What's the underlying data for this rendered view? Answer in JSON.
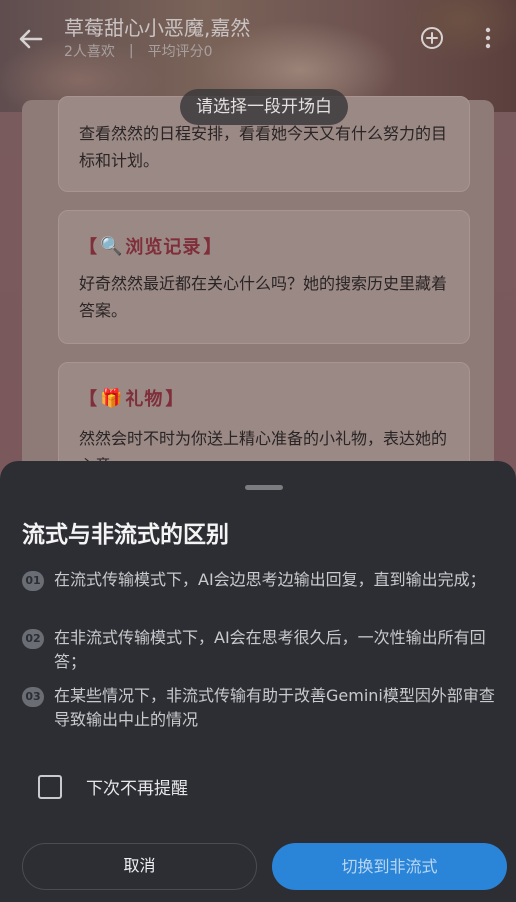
{
  "header": {
    "title": "草莓甜心小恶魔,嘉然",
    "likes": "2人喜欢",
    "separator": "|",
    "rating": "平均评分0",
    "prompt_pill": "请选择一段开场白"
  },
  "cards": [
    {
      "text": "查看然然的日程安排，看看她今天又有什么努力的目标和计划。"
    },
    {
      "bracket_open": "【",
      "emoji": "🔍",
      "title": "浏览记录",
      "bracket_close": "】",
      "text": "好奇然然最近都在关心什么吗？她的搜索历史里藏着答案。"
    },
    {
      "bracket_open": "【",
      "emoji": "🎁",
      "title": "礼物",
      "bracket_close": "】",
      "text": "然然会时不时为你送上精心准备的小礼物，表达她的心意。"
    }
  ],
  "sheet": {
    "title": "流式与非流式的区别",
    "notes": [
      {
        "num": "01",
        "text": "在流式传输模式下，AI会边思考边输出回复，直到输出完成；"
      },
      {
        "num": "02",
        "text": "在非流式传输模式下，AI会在思考很久后，一次性输出所有回答；"
      },
      {
        "num": "03",
        "text": "在某些情况下，非流式传输有助于改善Gemini模型因外部审查导致输出中止的情况"
      }
    ],
    "checkbox_label": "下次不再提醒",
    "checkbox_checked": false,
    "cancel_label": "取消",
    "switch_label": "切换到非流式"
  },
  "colors": {
    "sheet_bg": "#2c2e33",
    "primary_button": "#2a85d8",
    "card_title": "#7f2e3a"
  },
  "icons": {
    "back": "arrow-left-icon",
    "add": "plus-circle-icon",
    "more": "more-vertical-icon"
  }
}
